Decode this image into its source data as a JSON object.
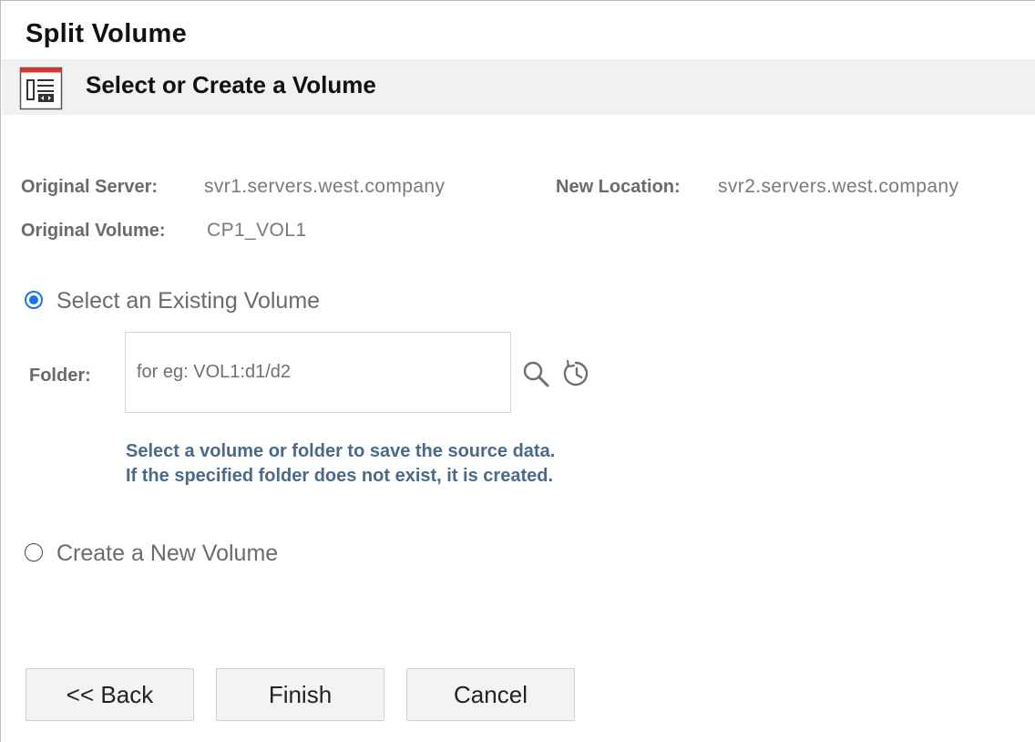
{
  "page": {
    "title": "Split Volume"
  },
  "section": {
    "title": "Select or Create a Volume",
    "icon": "volume-panel-icon"
  },
  "info": {
    "original_server_label": "Original Server:",
    "original_server_value": "svr1.servers.west.company",
    "new_location_label": "New Location:",
    "new_location_value": "svr2.servers.west.company",
    "original_volume_label": "Original Volume:",
    "original_volume_value": "CP1_VOL1"
  },
  "options": {
    "existing_label": "Select an Existing Volume",
    "existing_selected": true,
    "new_label": "Create a New Volume",
    "new_selected": false
  },
  "folder": {
    "label": "Folder:",
    "value": "",
    "placeholder": "for eg: VOL1:d1/d2",
    "browse_icon": "search-icon",
    "history_icon": "history-icon"
  },
  "help": {
    "line1": "Select a volume or folder to save the source data.",
    "line2": "If the specified folder does not exist, it is created."
  },
  "buttons": {
    "back": "<< Back",
    "finish": "Finish",
    "cancel": "Cancel"
  },
  "colors": {
    "accent": "#1a73e8",
    "help_text": "#4a6a8a",
    "header_bg": "#f1f1f1",
    "icon_red": "#d9342b"
  }
}
